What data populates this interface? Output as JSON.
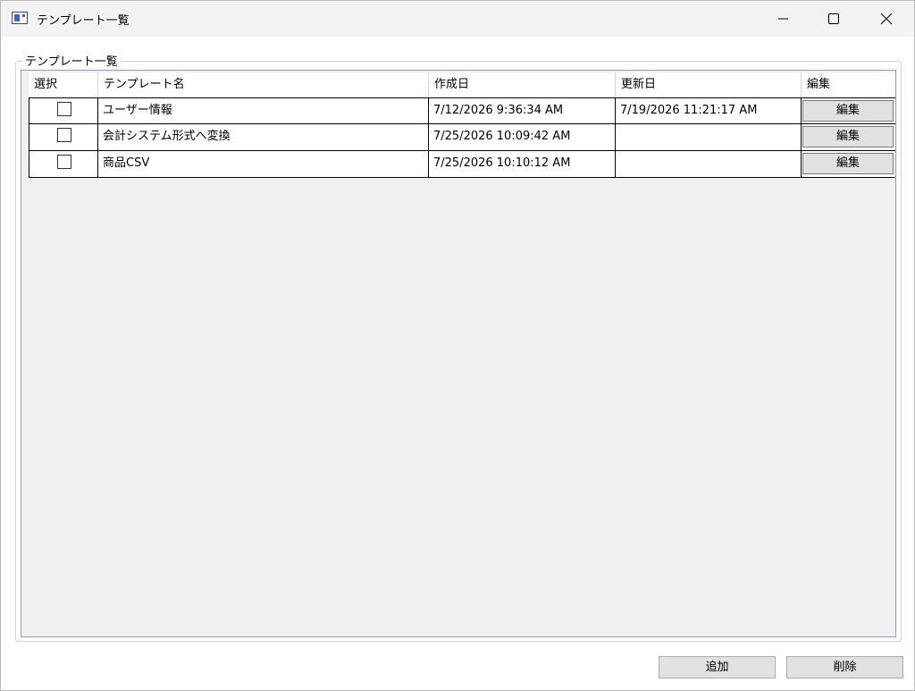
{
  "window": {
    "title": "テンプレート一覧"
  },
  "group": {
    "label": "テンプレート一覧"
  },
  "grid": {
    "columns": [
      "選択",
      "テンプレート名",
      "作成日",
      "更新日",
      "編集"
    ],
    "rows": [
      {
        "selected": false,
        "name": "ユーザー情報",
        "created": "7/12/2026 9:36:34 AM",
        "updated": "7/19/2026 11:21:17 AM",
        "edit_label": "編集"
      },
      {
        "selected": false,
        "name": "会計システム形式へ変換",
        "created": "7/25/2026 10:09:42 AM",
        "updated": "",
        "edit_label": "編集"
      },
      {
        "selected": false,
        "name": "商品CSV",
        "created": "7/25/2026 10:10:12 AM",
        "updated": "",
        "edit_label": "編集"
      }
    ]
  },
  "footer": {
    "add_label": "追加",
    "delete_label": "削除"
  },
  "icons": {
    "app": "window-app-icon",
    "minimize": "minimize-icon",
    "maximize": "maximize-icon",
    "close": "close-icon"
  }
}
